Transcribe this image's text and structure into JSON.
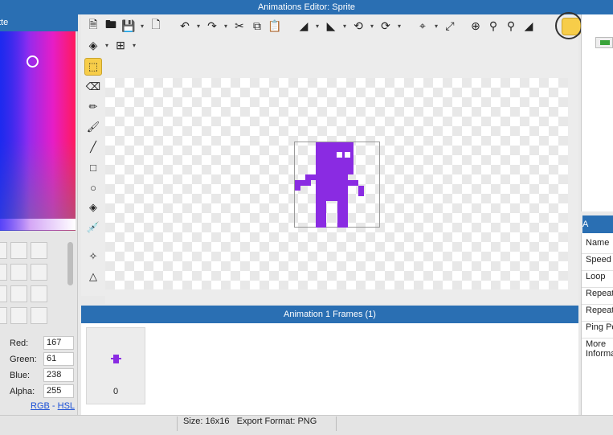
{
  "window": {
    "title": "Animations Editor: Sprite"
  },
  "palette": {
    "header": "tte",
    "red_label": "Red:",
    "red_value": "167",
    "green_label": "Green:",
    "green_value": "61",
    "blue_label": "Blue:",
    "blue_value": "238",
    "alpha_label": "Alpha:",
    "alpha_value": "255",
    "rgb_link": "RGB",
    "sep": "-",
    "hsl_link": "HSL"
  },
  "toolbar": {
    "icons": [
      "new-file-icon",
      "open-folder-icon",
      "save-icon",
      "save-as-icon",
      "undo-icon",
      "redo-icon",
      "cut-icon",
      "copy-icon",
      "paste-icon",
      "flip-horizontal-icon",
      "flip-vertical-icon",
      "rotate-left-icon",
      "rotate-right-icon",
      "crop-icon",
      "resize-icon",
      "zoom-in-icon",
      "zoom-out-icon",
      "zoom-fit-icon",
      "invert-icon",
      "layers-icon",
      "grid-icon"
    ]
  },
  "tools": [
    "select-tool",
    "eraser-tool",
    "pencil-tool",
    "brush-tool",
    "line-tool",
    "rectangle-tool",
    "ellipse-tool",
    "fill-tool",
    "eyedropper-tool",
    "point-tool",
    "polygon-tool"
  ],
  "sprite": {
    "color": "#8a2be2"
  },
  "frames": {
    "header": "Animation 1 Frames (1)",
    "items": [
      {
        "label": "0"
      }
    ]
  },
  "properties": {
    "rows": [
      "Name",
      "Speed",
      "Loop",
      "Repeat",
      "Repeat",
      "Ping Po",
      "More\nInforma"
    ]
  },
  "status": {
    "size": "Size: 16x16",
    "format": "Export Format: PNG"
  },
  "colors": {
    "accent": "#2a6fb3",
    "highlight": "#f7cd49"
  }
}
